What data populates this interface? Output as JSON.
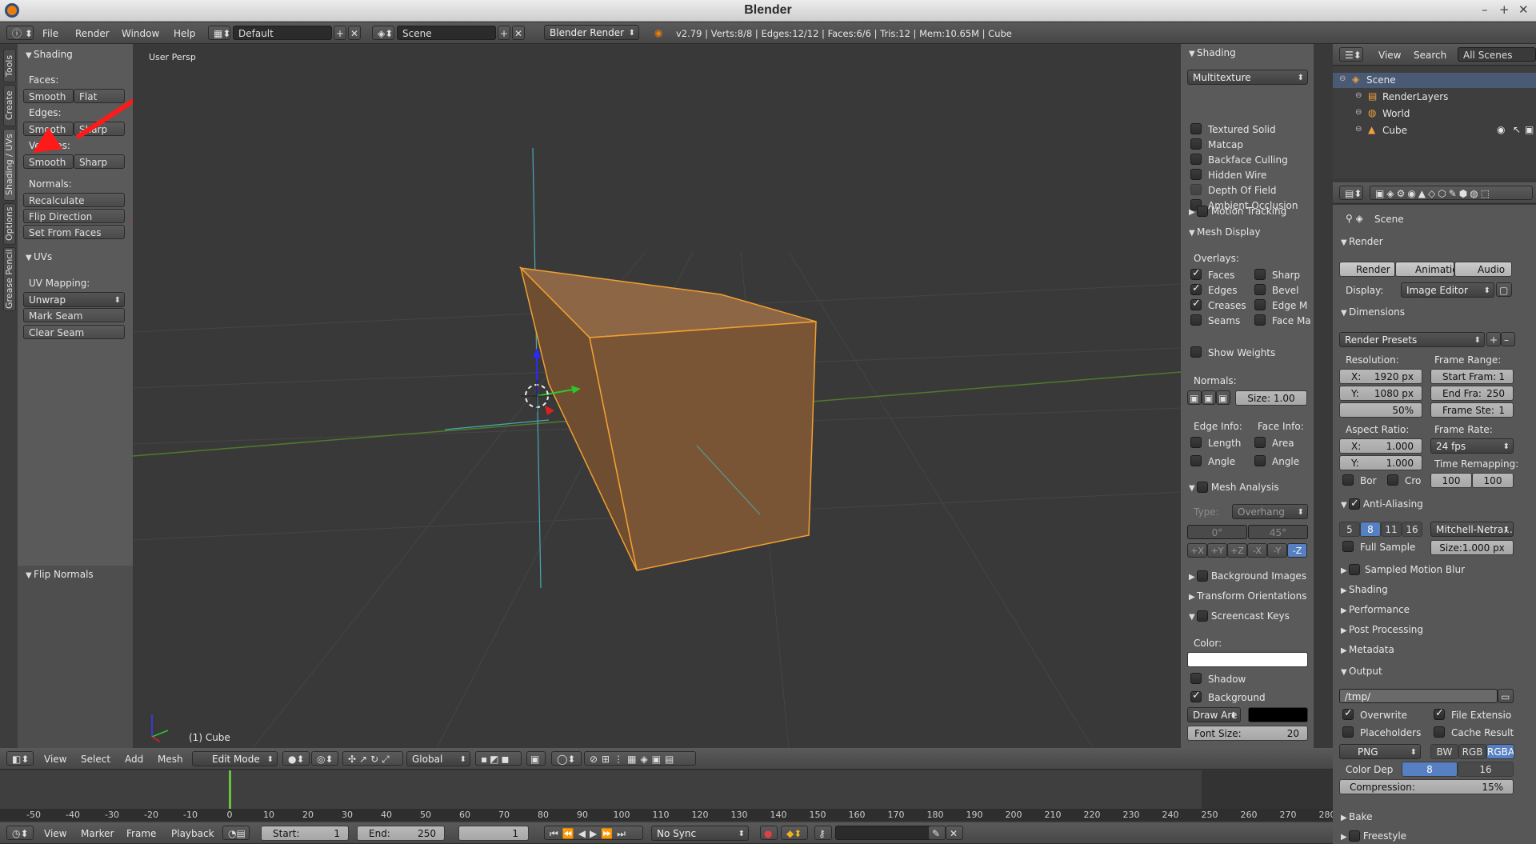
{
  "window": {
    "title": "Blender"
  },
  "top_header": {
    "menus": [
      "File",
      "Render",
      "Window",
      "Help"
    ],
    "layout_name": "Default",
    "scene_name": "Scene",
    "engine": "Blender Render",
    "stats": "v2.79 | Verts:8/8 | Edges:12/12 | Faces:6/6 | Tris:12 | Mem:10.65M | Cube"
  },
  "toolshelf": {
    "vertical_tabs": [
      "Tools",
      "Create",
      "Shading / UVs",
      "Options",
      "Grease Pencil"
    ],
    "shading_title": "Shading",
    "faces_label": "Faces:",
    "faces_smooth": "Smooth",
    "faces_flat": "Flat",
    "edges_label": "Edges:",
    "edges_smooth": "Smooth",
    "edges_sharp": "Sharp",
    "vertices_label": "Vertices:",
    "vert_smooth": "Smooth",
    "vert_sharp": "Sharp",
    "normals_label": "Normals:",
    "recalculate": "Recalculate",
    "flip_direction": "Flip Direction",
    "set_from_faces": "Set From Faces",
    "uvs_title": "UVs",
    "uv_mapping_label": "UV Mapping:",
    "unwrap": "Unwrap",
    "mark_seam": "Mark Seam",
    "clear_seam": "Clear Seam",
    "operator_title": "Flip Normals"
  },
  "viewport": {
    "view_label": "User Persp",
    "object_label": "(1) Cube",
    "colors": {
      "bg": "#393939",
      "cube_face": "#7a5535",
      "cube_top": "#8d6645",
      "cube_edge": "#f0a030"
    }
  },
  "nprop": {
    "shading_title": "Shading",
    "shading_mode": "Multitexture",
    "shading_opts": [
      {
        "label": "Textured Solid",
        "on": false,
        "dim": false
      },
      {
        "label": "Matcap",
        "on": false,
        "dim": false
      },
      {
        "label": "Backface Culling",
        "on": false,
        "dim": false
      },
      {
        "label": "Hidden Wire",
        "on": false,
        "dim": false
      },
      {
        "label": "Depth Of Field",
        "on": false,
        "dim": true
      },
      {
        "label": "Ambient Occlusion",
        "on": false,
        "dim": false
      }
    ],
    "motion_tracking": "Motion Tracking",
    "mesh_display": "Mesh Display",
    "overlays_label": "Overlays:",
    "overlays_left": [
      {
        "label": "Faces",
        "on": true
      },
      {
        "label": "Edges",
        "on": true
      },
      {
        "label": "Creases",
        "on": true
      },
      {
        "label": "Seams",
        "on": false
      }
    ],
    "overlays_right": [
      {
        "label": "Sharp",
        "on": false
      },
      {
        "label": "Bevel",
        "on": false
      },
      {
        "label": "Edge M",
        "on": false
      },
      {
        "label": "Face Ma",
        "on": false
      }
    ],
    "show_weights": "Show Weights",
    "normals_label": "Normals:",
    "normals_size": "Size: 1.00",
    "edge_info_label": "Edge Info:",
    "face_info_label": "Face Info:",
    "edge_info": [
      "Length",
      "Angle"
    ],
    "face_info": [
      "Area",
      "Angle"
    ],
    "mesh_analysis": "Mesh Analysis",
    "type_label": "Type:",
    "type_value": "Overhang",
    "angle_min": "0°",
    "angle_max": "45°",
    "axes": [
      "+X",
      "+Y",
      "+Z",
      "-X",
      "-Y",
      "-Z"
    ],
    "background_images": "Background Images",
    "transform_orientations": "Transform Orientations",
    "screencast_keys": "Screencast Keys",
    "color_label": "Color:",
    "shadow": "Shadow",
    "background": "Background",
    "draw_area": "Draw Are",
    "font_size": "Font Size:",
    "font_size_value": "20"
  },
  "outliner": {
    "view": "View",
    "search": "Search",
    "filter": "All Scenes",
    "items": [
      {
        "label": "Scene",
        "indent": 0
      },
      {
        "label": "RenderLayers",
        "indent": 1
      },
      {
        "label": "World",
        "indent": 1
      },
      {
        "label": "Cube",
        "indent": 1
      }
    ]
  },
  "properties": {
    "context": "Scene",
    "render_title": "Render",
    "render_btn": "Render",
    "animation_btn": "Animation",
    "audio_btn": "Audio",
    "display_label": "Display:",
    "display_value": "Image Editor",
    "dimensions_title": "Dimensions",
    "render_presets": "Render Presets",
    "resolution_label": "Resolution:",
    "res_x": "X:",
    "res_x_val": "1920 px",
    "res_y": "Y:",
    "res_y_val": "1080 px",
    "res_pct": "50%",
    "frame_range_label": "Frame Range:",
    "start_frame": "Start Fram:",
    "start_frame_val": "1",
    "end_frame": "End Fra:",
    "end_frame_val": "250",
    "frame_step": "Frame Ste:",
    "frame_step_val": "1",
    "aspect_label": "Aspect Ratio:",
    "aspect_x": "X:",
    "aspect_x_val": "1.000",
    "aspect_y": "Y:",
    "aspect_y_val": "1.000",
    "frame_rate_label": "Frame Rate:",
    "frame_rate": "24 fps",
    "time_remap_label": "Time Remapping:",
    "time_old": "100",
    "time_new": "100",
    "border": "Bor",
    "crop": "Cro",
    "aa_title": "Anti-Aliasing",
    "aa_samples": [
      "5",
      "8",
      "11",
      "16"
    ],
    "aa_filter": "Mitchell-Netra...",
    "full_sample": "Full Sample",
    "aa_size": "Size:1.000 px",
    "collapsed": [
      "Sampled Motion Blur",
      "Shading",
      "Performance",
      "Post Processing",
      "Metadata"
    ],
    "output_title": "Output",
    "output_path": "/tmp/",
    "overwrite": "Overwrite",
    "file_extension": "File Extensio",
    "placeholders": "Placeholders",
    "cache_result": "Cache Result",
    "format": "PNG",
    "bw": "BW",
    "rgb": "RGB",
    "rgba": "RGBA",
    "color_depth_label": "Color Dep",
    "depth8": "8",
    "depth16": "16",
    "compression": "Compression:",
    "compression_val": "15%",
    "bake": "Bake",
    "freestyle": "Freestyle"
  },
  "view3d_header": {
    "menus": [
      "View",
      "Select",
      "Add",
      "Mesh"
    ],
    "mode": "Edit Mode",
    "orientation": "Global"
  },
  "timeline": {
    "ticks": [
      "-50",
      "-40",
      "-30",
      "-20",
      "-10",
      "0",
      "10",
      "20",
      "30",
      "40",
      "50",
      "60",
      "70",
      "80",
      "90",
      "100",
      "110",
      "120",
      "130",
      "140",
      "150",
      "160",
      "170",
      "180",
      "190",
      "200",
      "210",
      "220",
      "230",
      "240",
      "250",
      "260",
      "270",
      "280"
    ],
    "menus": [
      "View",
      "Marker",
      "Frame",
      "Playback"
    ],
    "start_label": "Start:",
    "start_val": "1",
    "end_label": "End:",
    "end_val": "250",
    "current": "1",
    "sync": "No Sync"
  }
}
